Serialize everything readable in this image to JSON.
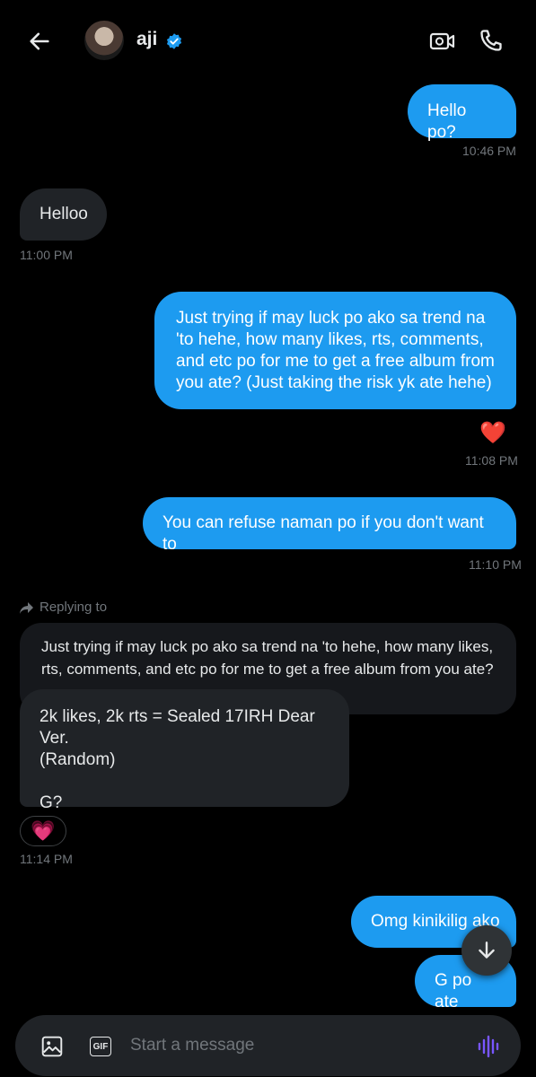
{
  "header": {
    "back_icon": "arrow-left-icon",
    "name": "aji",
    "verified_icon": "verified-badge-icon",
    "video_icon": "video-camera-icon",
    "call_icon": "phone-icon"
  },
  "messages": [
    {
      "dir": "out",
      "text": "Hello po?",
      "time": "10:46 PM"
    },
    {
      "dir": "in",
      "text": "Helloo",
      "time": "11:00 PM"
    },
    {
      "dir": "out",
      "text": "Just trying if may luck po ako sa trend na 'to hehe, how many likes, rts, comments, and etc po for me to get a free album from you ate? (Just taking the risk yk ate hehe)",
      "reaction": "❤️",
      "time": "11:08 PM"
    },
    {
      "dir": "out",
      "text": "You can refuse naman po if you don't want to",
      "time": "11:10 PM"
    },
    {
      "dir": "in",
      "replying_label": "Replying to",
      "quoted": "Just trying if may luck po ako sa trend na 'to hehe, how many likes, rts, comments, and etc po for me to get a free album from you ate? ...",
      "text_line1": "2k likes, 2k rts = Sealed 17IRH Dear Ver.",
      "text_line2": "(Random)",
      "text_line3": "G?",
      "reaction": "💗",
      "time": "11:14 PM"
    },
    {
      "dir": "out",
      "text": "Omg kinikilig ako"
    },
    {
      "dir": "out",
      "text": "G po ate"
    }
  ],
  "composer": {
    "placeholder": "Start a message",
    "image_icon": "image-icon",
    "gif_label": "GIF",
    "voice_icon": "voice-waveform-icon"
  },
  "scroll_icon": "arrow-down-icon",
  "colors": {
    "background": "#000000",
    "outgoing_bubble": "#1d9bf0",
    "incoming_bubble": "#202327",
    "timestamp": "#71767b",
    "voice_accent": "#7856ff"
  }
}
